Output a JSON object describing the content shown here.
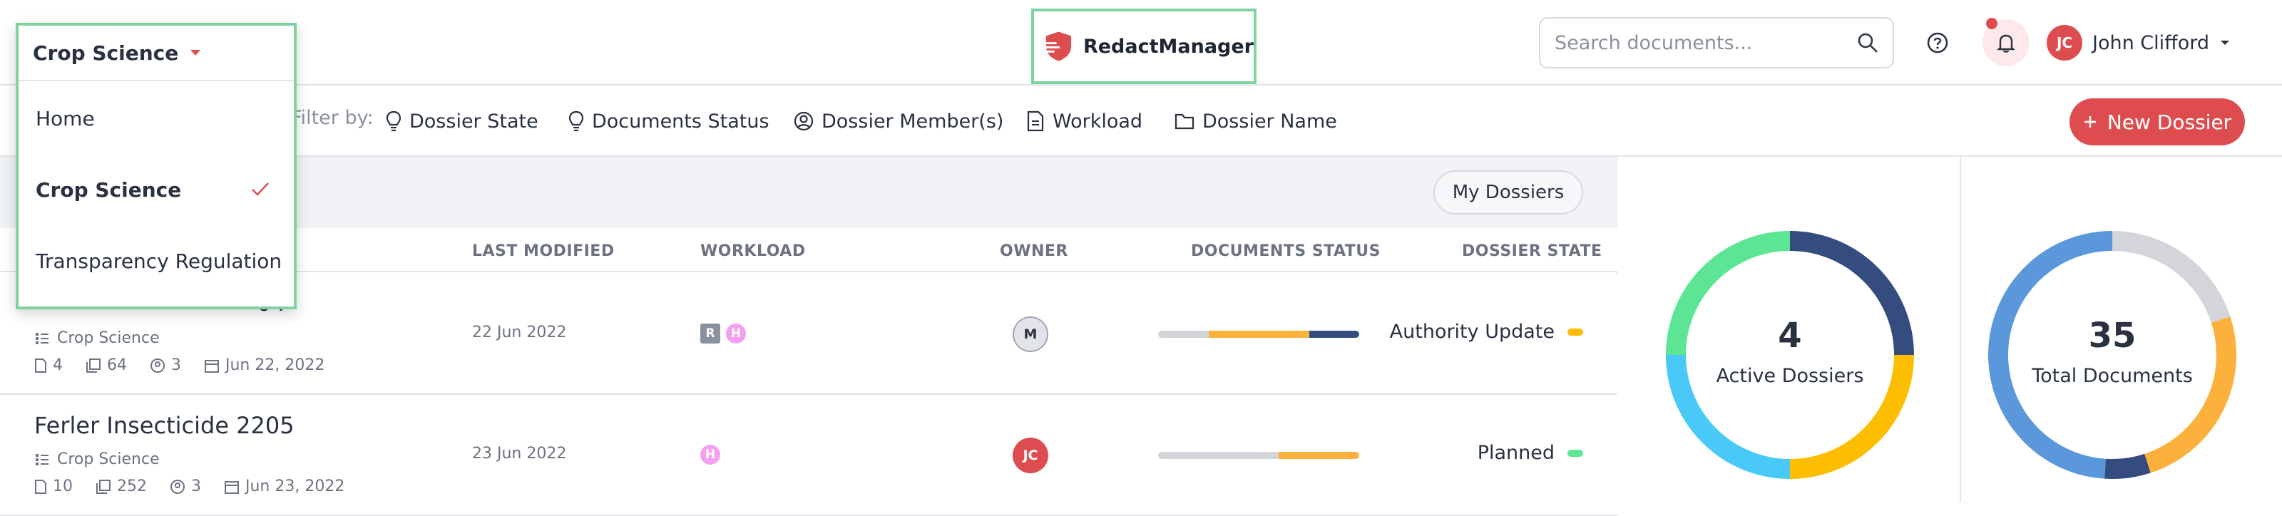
{
  "colors": {
    "accent": "#dd4d50",
    "green": "#5ce594",
    "navy": "#354c7f",
    "amber": "#fdbd00",
    "cyan": "#48c9f7",
    "blue": "#5b97db",
    "grey": "#d3d5da",
    "orange": "#fbb13c"
  },
  "header": {
    "workspace": "Crop Science",
    "app_name": "RedactManager",
    "search_placeholder": "Search documents...",
    "user_initials": "JC",
    "user_name": "John Clifford"
  },
  "dropdown": {
    "current": "Crop Science",
    "items": [
      {
        "label": "Home",
        "selected": false
      },
      {
        "label": "Crop Science",
        "selected": true
      },
      {
        "label": "Transparency Regulation",
        "selected": false
      }
    ]
  },
  "filters": {
    "label": "Filter by:",
    "items": [
      "Dossier State",
      "Documents Status",
      "Dossier Member(s)",
      "Workload",
      "Dossier Name"
    ]
  },
  "new_dossier_label": "New Dossier",
  "my_dossiers_label": "My Dossiers",
  "columns": [
    "LAST MODIFIED",
    "WORKLOAD",
    "OWNER",
    "DOCUMENTS STATUS",
    "DOSSIER STATE"
  ],
  "rows": [
    {
      "title_fragment": "04",
      "category": "Crop Science",
      "docs": "4",
      "pages": "64",
      "members": "3",
      "date": "Jun 22, 2022",
      "last_modified": "22 Jun 2022",
      "workload": [
        "R",
        "H"
      ],
      "owner": "M",
      "status": [
        {
          "pct": 0.25,
          "color": "#d3d5da"
        },
        {
          "pct": 0.5,
          "color": "#fbb13c"
        },
        {
          "pct": 0.25,
          "color": "#354c7f"
        }
      ],
      "state": "Authority Update",
      "state_color": "#fdbd00"
    },
    {
      "title": "Ferler Insecticide 2205",
      "category": "Crop Science",
      "docs": "10",
      "pages": "252",
      "members": "3",
      "date": "Jun 23, 2022",
      "last_modified": "23 Jun 2022",
      "workload": [
        "H"
      ],
      "owner": "JC",
      "status": [
        {
          "pct": 0.6,
          "color": "#d3d5da"
        },
        {
          "pct": 0.4,
          "color": "#fbb13c"
        }
      ],
      "state": "Planned",
      "state_color": "#5ce594"
    }
  ],
  "stats": {
    "active": {
      "value": "4",
      "label": "Active Dossiers",
      "segments": [
        {
          "pct": 0.25,
          "color": "#354c7f"
        },
        {
          "pct": 0.25,
          "color": "#fdbd00"
        },
        {
          "pct": 0.25,
          "color": "#48c9f7"
        },
        {
          "pct": 0.25,
          "color": "#5ce594"
        }
      ]
    },
    "total": {
      "value": "35",
      "label": "Total Documents",
      "segments": [
        {
          "pct": 0.2,
          "color": "#d3d5da"
        },
        {
          "pct": 0.25,
          "color": "#fbb13c"
        },
        {
          "pct": 0.06,
          "color": "#354c7f"
        },
        {
          "pct": 0.49,
          "color": "#5b97db"
        }
      ]
    }
  }
}
